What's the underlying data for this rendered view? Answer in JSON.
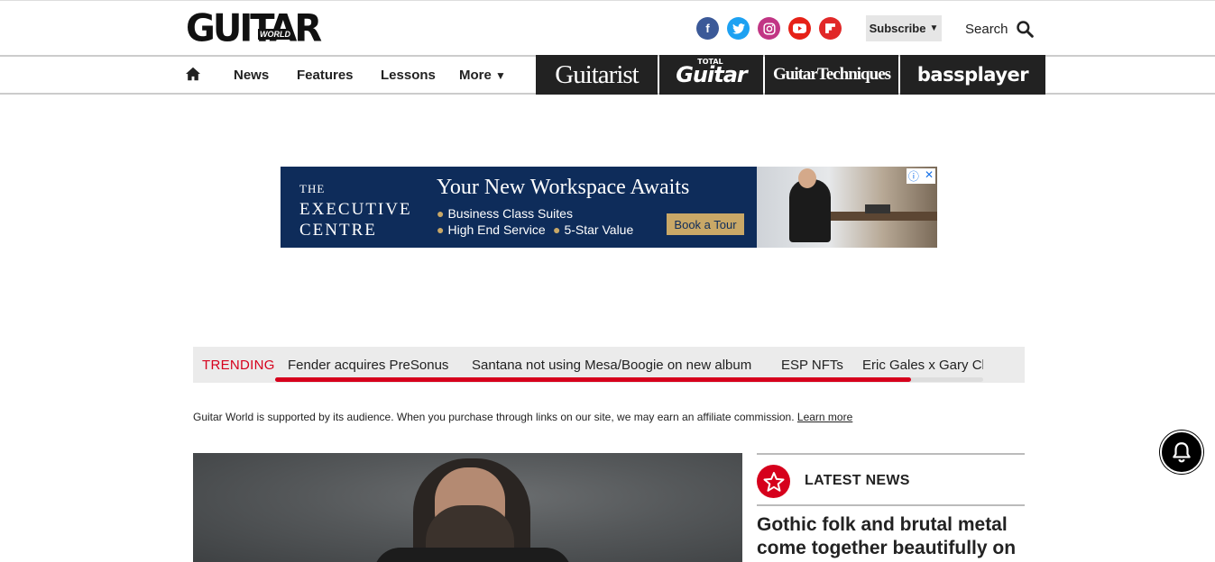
{
  "header": {
    "logo_text": "GUITAR",
    "logo_badge": "WORLD",
    "subscribe_label": "Subscribe",
    "search_label": "Search",
    "social": [
      {
        "icon": "facebook-icon",
        "glyph": "f",
        "color": "#3b5998"
      },
      {
        "icon": "twitter-icon",
        "glyph": "t",
        "color": "#1da1f2"
      },
      {
        "icon": "instagram-icon",
        "glyph": "◎",
        "color": "#c13584"
      },
      {
        "icon": "youtube-icon",
        "glyph": "▶",
        "color": "#e62117"
      },
      {
        "icon": "flipboard-icon",
        "glyph": "F",
        "color": "#e12828"
      }
    ]
  },
  "nav": {
    "items": [
      "News",
      "Features",
      "Lessons",
      "More"
    ],
    "brands": [
      "Guitarist",
      "Guitar",
      "GuitarTechniques",
      "bassplayer"
    ],
    "brand_total_small": "TOTAL"
  },
  "ad": {
    "logo_the": "THE",
    "logo_line1": "EXECUTIVE",
    "logo_line2": "CENTRE",
    "headline": "Your New Workspace Awaits",
    "bullet1": "Business Class Suites",
    "bullet2": "High End Service",
    "bullet3": "5-Star Value",
    "cta": "Book a Tour"
  },
  "trending": {
    "label": "TRENDING",
    "items": [
      "Fender acquires PreSonus",
      "Santana not using Mesa/Boogie on new album",
      "ESP NFTs",
      "Eric Gales x Gary Cla"
    ]
  },
  "disclaimer": {
    "text": "Guitar World is supported by its audience. When you purchase through links on our site, we may earn an affiliate commission.",
    "link": "Learn more"
  },
  "latest": {
    "title": "LATEST NEWS",
    "article_title": "Gothic folk and brutal metal come together beautifully on"
  },
  "colors": {
    "accent_red": "#d6001c",
    "brand_dark": "#222222",
    "ad_navy": "#0e2c5a",
    "ad_gold": "#c9a867"
  }
}
